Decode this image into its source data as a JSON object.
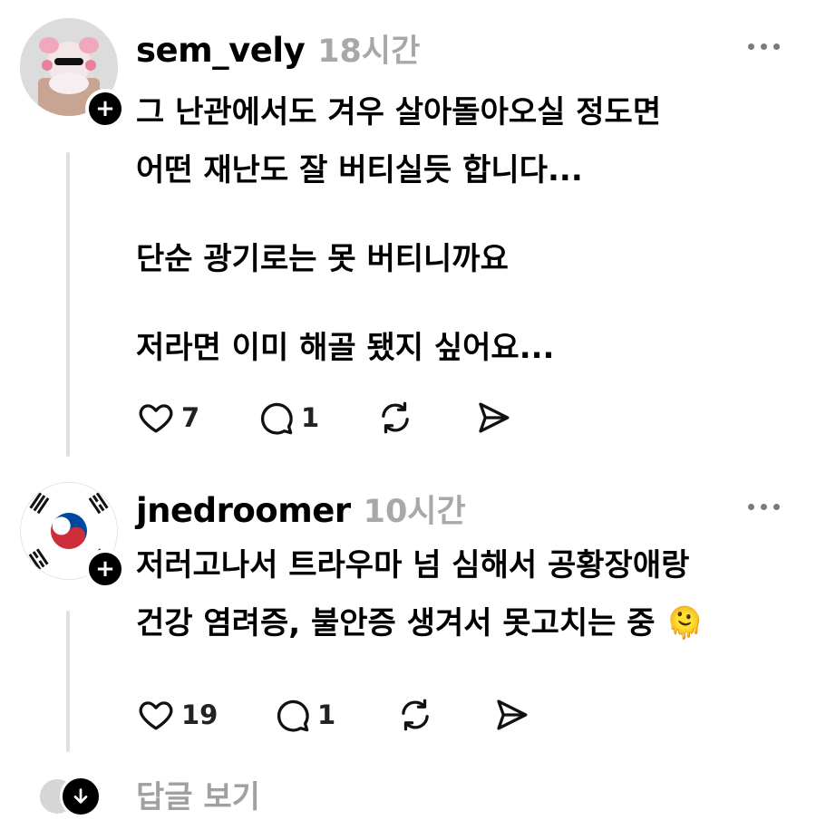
{
  "posts": [
    {
      "username": "sem_vely",
      "time": "18시간",
      "avatar_icon": "profile-character-avatar",
      "paragraphs": [
        "그 난관에서도 겨우 살아돌아오실 정도면",
        "어떤 재난도 잘 버티실듯 합니다...",
        "단순 광기로는 못 버티니까요",
        "저라면 이미 해골 됐지 싶어요..."
      ],
      "likes": "7",
      "comments": "1"
    },
    {
      "username": "jnedroomer",
      "time": "10시간",
      "avatar_icon": "korean-flag-avatar",
      "paragraphs": [
        "저러고나서 트라우마 넘 심해서 공황장애랑",
        "건강 염려증, 불안증 생겨서 못고치는 중 🫠"
      ],
      "likes": "19",
      "comments": "1"
    }
  ],
  "view_replies_label": "답글 보기",
  "colors": {
    "text": "#000000",
    "muted": "#a8a8a8",
    "thread_line": "#e0e0e0",
    "flag_red": "#cd2e3a",
    "flag_blue": "#0047a0"
  }
}
